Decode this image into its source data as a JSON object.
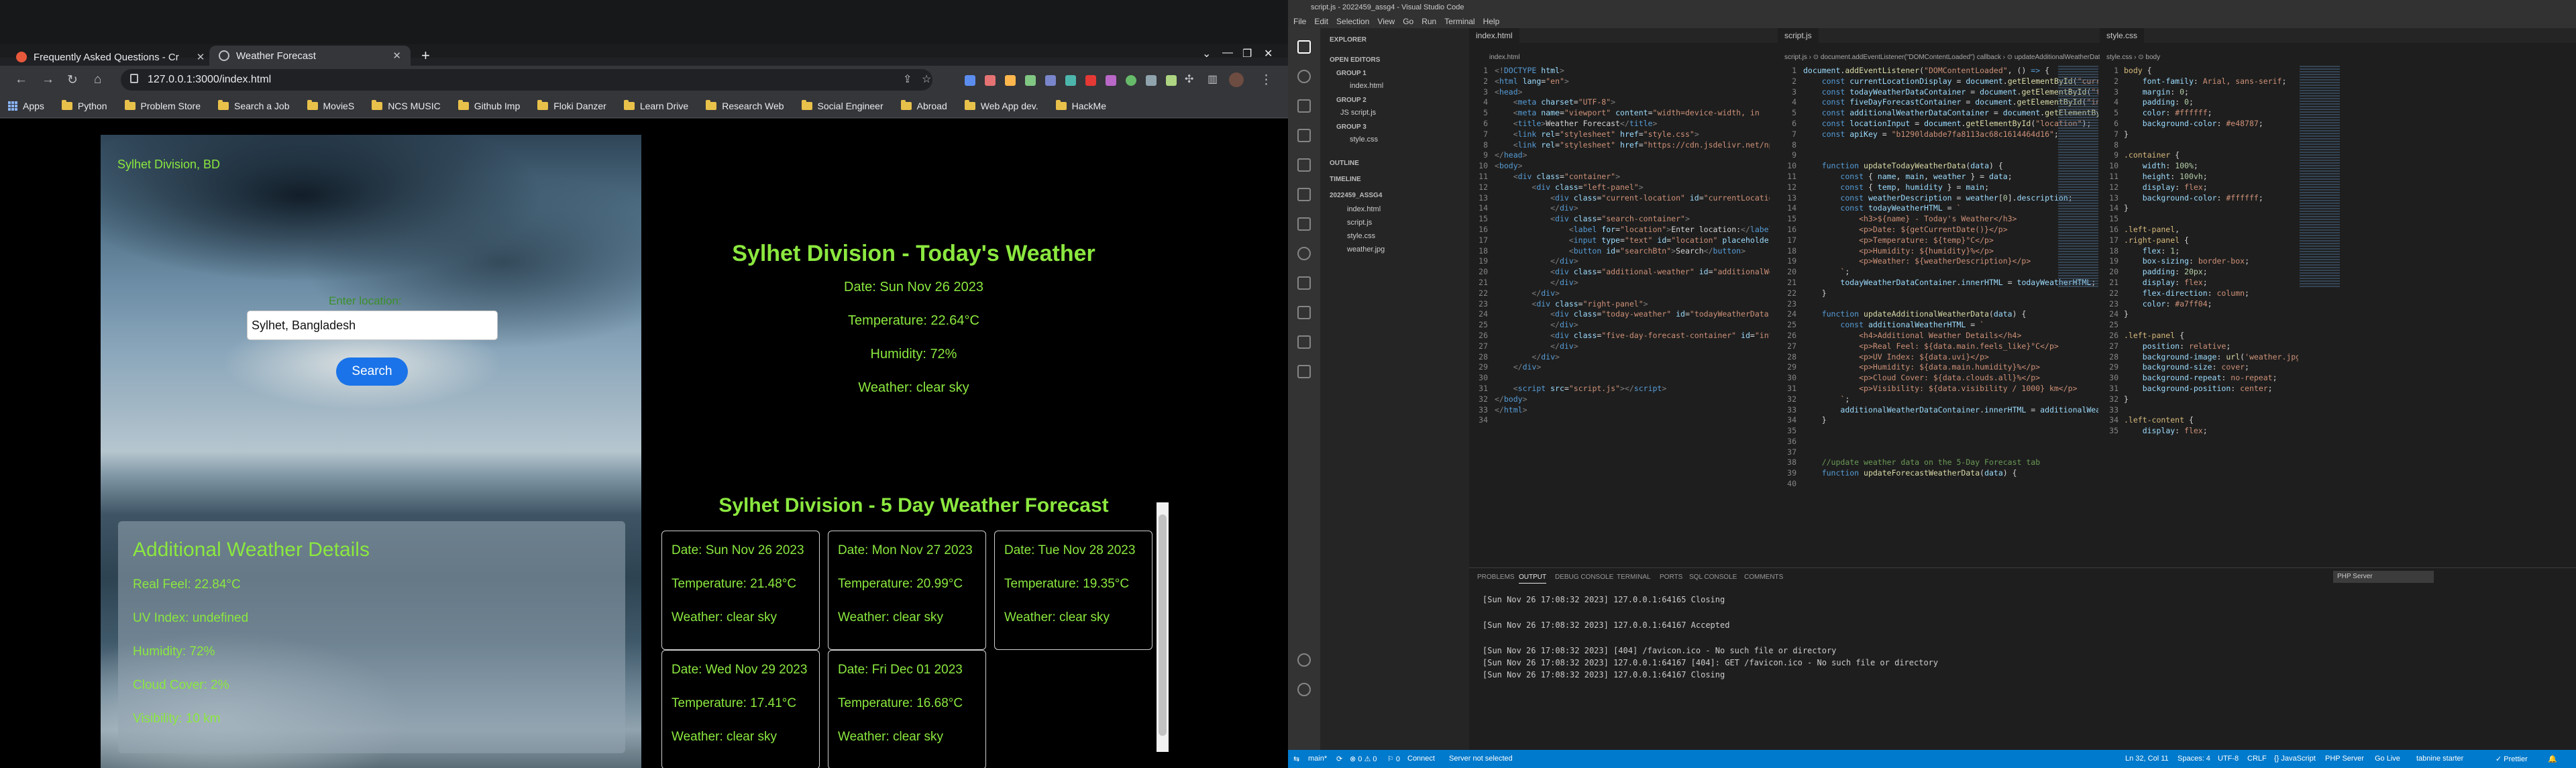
{
  "browser": {
    "tabs": [
      {
        "title": "Frequently Asked Questions - Cr",
        "icon": "faq-favicon-icon"
      },
      {
        "title": "Weather Forecast",
        "icon": "globe-icon"
      }
    ],
    "url": "127.0.0.1:3000/index.html",
    "bookmarks": [
      "Apps",
      "Python",
      "Problem Store",
      "Search a Job",
      "MovieS",
      "NCS MUSIC",
      "Github Imp",
      "Floki Danzer",
      "Learn Drive",
      "Research Web",
      "Social Engineer",
      "Abroad",
      "Web App dev.",
      "HackMe"
    ]
  },
  "weather": {
    "current_location": "Sylhet Division, BD",
    "search_label": "Enter location:",
    "search_value": "Sylhet, Bangladesh",
    "search_button": "Search",
    "additional": {
      "heading": "Additional Weather Details",
      "rows": [
        "Real Feel: 22.84°C",
        "UV Index: undefined",
        "Humidity: 72%",
        "Cloud Cover: 2%",
        "Visibility: 10 km"
      ]
    },
    "today": {
      "title": "Sylhet Division - Today's Weather",
      "date": "Date: Sun Nov 26 2023",
      "temperature": "Temperature: 22.64°C",
      "humidity": "Humidity: 72%",
      "weather": "Weather: clear sky"
    },
    "forecast": {
      "title": "Sylhet Division - 5 Day Weather Forecast",
      "days": [
        {
          "date": "Date: Sun Nov 26 2023",
          "temp": "Temperature: 21.48°C",
          "weather": "Weather: clear sky"
        },
        {
          "date": "Date: Mon Nov 27 2023",
          "temp": "Temperature: 20.99°C",
          "weather": "Weather: clear sky"
        },
        {
          "date": "Date: Tue Nov 28 2023",
          "temp": "Temperature: 19.35°C",
          "weather": "Weather: clear sky"
        },
        {
          "date": "Date: Wed Nov 29 2023",
          "temp": "Temperature: 17.41°C",
          "weather": "Weather: clear sky"
        },
        {
          "date": "Date: Fri Dec 01 2023",
          "temp": "Temperature: 16.68°C",
          "weather": "Weather: clear sky"
        }
      ]
    }
  },
  "vscode": {
    "title": "script.js - 2022459_assg4 - Visual Studio Code",
    "menu": [
      "File",
      "Edit",
      "Selection",
      "View",
      "Go",
      "Run",
      "Terminal",
      "Help"
    ],
    "explorer": {
      "header": "EXPLORER",
      "open_editors": "OPEN EDITORS",
      "groups": [
        {
          "name": "GROUP 1",
          "files": [
            "index.html"
          ]
        },
        {
          "name": "GROUP 2",
          "files": [
            "JS script.js"
          ]
        },
        {
          "name": "GROUP 3",
          "files": [
            "style.css"
          ]
        }
      ],
      "outline": "OUTLINE",
      "timeline": "TIMELINE",
      "project": "2022459_ASSG4",
      "project_files": [
        "index.html",
        "script.js",
        "style.css",
        "weather.jpg"
      ]
    },
    "editors": [
      {
        "tab": "index.html",
        "crumb": "index.html"
      },
      {
        "tab": "script.js",
        "crumb": "script.js › ⊙ document.addEventListener(\"DOMContentLoaded\") callback › ⊙ updateAdditionalWeatherData"
      },
      {
        "tab": "style.css",
        "crumb": "style.css › ⊙ body"
      }
    ],
    "panel": {
      "tabs": [
        "PROBLEMS",
        "OUTPUT",
        "DEBUG CONSOLE",
        "TERMINAL",
        "PORTS",
        "SQL CONSOLE",
        "COMMENTS"
      ],
      "active_tab": "OUTPUT",
      "channel": "PHP Server",
      "log": [
        "[Sun Nov 26 17:08:32 2023] 127.0.0.1:64165 Closing",
        "[Sun Nov 26 17:08:32 2023] 127.0.0.1:64167 Accepted",
        "[Sun Nov 26 17:08:32 2023] [404] /favicon.ico - No such file or directory",
        "[Sun Nov 26 17:08:32 2023] 127.0.0.1:64167 [404]: GET /favicon.ico - No such file or directory",
        "[Sun Nov 26 17:08:32 2023] 127.0.0.1:64167 Closing"
      ]
    },
    "status": {
      "branch": "main*",
      "sync": "⟳",
      "problems": "⊗ 0 ⚠ 0",
      "ports": "⚐ 0",
      "connect": "Connect",
      "server": "Server not selected",
      "position": "Ln 32, Col 11",
      "spaces": "Spaces: 4",
      "encoding": "UTF-8",
      "eol": "CRLF",
      "language": "{} JavaScript",
      "php": "PHP Server",
      "golive": "Go Live",
      "tabnine": "tabnine starter",
      "prettier": "✓ Prettier"
    }
  }
}
